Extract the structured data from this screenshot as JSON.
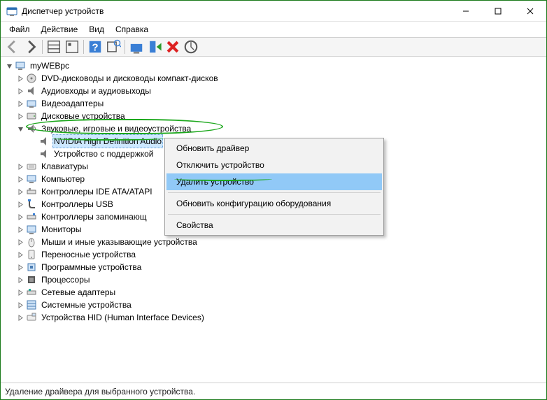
{
  "window": {
    "title": "Диспетчер устройств"
  },
  "menu": {
    "file": "Файл",
    "action": "Действие",
    "view": "Вид",
    "help": "Справка"
  },
  "root": {
    "name": "myWEBpc"
  },
  "categories": [
    {
      "label": "DVD-дисководы и дисководы компакт-дисков"
    },
    {
      "label": "Аудиовходы и аудиовыходы"
    },
    {
      "label": "Видеоадаптеры"
    },
    {
      "label": "Дисковые устройства"
    },
    {
      "label": "Звуковые, игровые и видеоустройства",
      "children": [
        {
          "label": "NVIDIA High Definition Audio",
          "selected": true
        },
        {
          "label": "Устройство с поддержкой"
        }
      ]
    },
    {
      "label": "Клавиатуры"
    },
    {
      "label": "Компьютер"
    },
    {
      "label": "Контроллеры IDE ATA/ATAPI"
    },
    {
      "label": "Контроллеры USB"
    },
    {
      "label": "Контроллеры запоминающ"
    },
    {
      "label": "Мониторы"
    },
    {
      "label": "Мыши и иные указывающие устройства"
    },
    {
      "label": "Переносные устройства"
    },
    {
      "label": "Программные устройства"
    },
    {
      "label": "Процессоры"
    },
    {
      "label": "Сетевые адаптеры"
    },
    {
      "label": "Системные устройства"
    },
    {
      "label": "Устройства HID (Human Interface Devices)"
    }
  ],
  "context_menu": [
    {
      "label": "Обновить драйвер"
    },
    {
      "label": "Отключить устройство"
    },
    {
      "label": "Удалить устройство",
      "highlight": true
    },
    {
      "sep": true
    },
    {
      "label": "Обновить конфигурацию оборудования"
    },
    {
      "sep": true
    },
    {
      "label": "Свойства"
    }
  ],
  "statusbar": {
    "text": "Удаление драйвера для выбранного устройства."
  }
}
